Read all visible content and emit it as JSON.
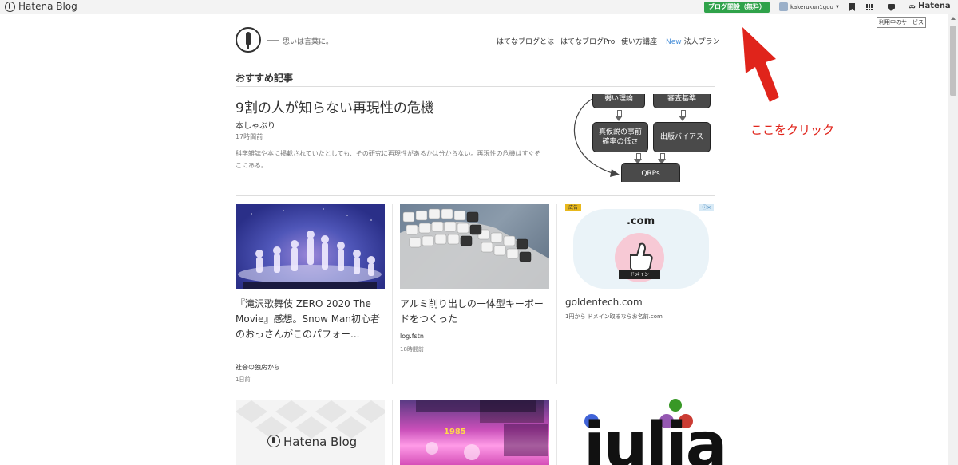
{
  "topbar": {
    "brand": "Hatena Blog",
    "signup_label": "ブログ開設（無料）",
    "username": "kakerukun1gou",
    "hatena_label": "Hatena",
    "tooltip": "利用中のサービス"
  },
  "header": {
    "tagline": "思いは言葉に。",
    "nav": [
      {
        "label": "はてなブログとは"
      },
      {
        "label": "はてなブログPro"
      },
      {
        "label": "使い方講座"
      },
      {
        "label": "法人プラン",
        "badge": "New"
      }
    ]
  },
  "section": {
    "title": "おすすめ記事"
  },
  "featured": {
    "title": "9割の人が知らない再現性の危機",
    "source": "本しゃぶり",
    "time": "17時間前",
    "description": "科学雑誌や本に掲載されていたとしても、その研究に再現性があるかは分からない。再現性の危機はすぐそこにある。",
    "diagram": {
      "box1": "弱い理論",
      "box2": "審査基準",
      "box3_line1": "真仮説の事前",
      "box3_line2": "確率の低さ",
      "box4": "出版バイアス",
      "box5": "QRPs"
    }
  },
  "cards": [
    {
      "title": "『滝沢歌舞伎 ZERO 2020 The Movie』感想。Snow Man初心者のおっさんがこのパフォー...",
      "source": "社会の独房から",
      "time": "1日前"
    },
    {
      "title": "アルミ削り出しの一体型キーボードをつくった",
      "source": "log.fstn",
      "time": "18時間前"
    }
  ],
  "ad": {
    "badge": "広告",
    "close_icons": "ⓘ✕",
    "image_com": ".com",
    "image_banner": "ドメイン",
    "domain": "goldentech.com",
    "description": "1円から ドメイン取るならお名前.com"
  },
  "row2": {
    "hatena_logo": "Hatena Blog",
    "julia_text": "julia",
    "julia_colors": [
      "#4063d8",
      "#389826",
      "#9558b2",
      "#cb3c33"
    ]
  },
  "annotation": {
    "text": "ここをクリック",
    "color": "#e0241b"
  }
}
